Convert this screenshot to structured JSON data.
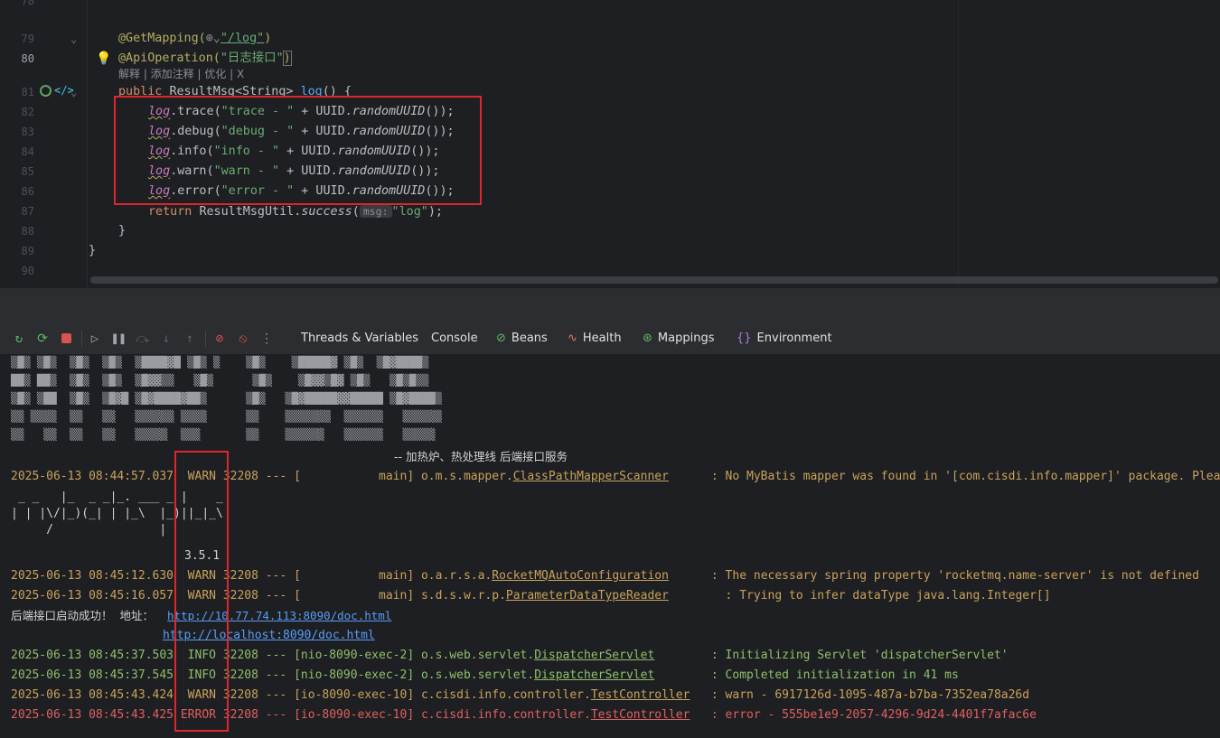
{
  "editor": {
    "line_numbers": [
      "78",
      "79",
      "80",
      "81",
      "82",
      "83",
      "84",
      "85",
      "86",
      "87",
      "88",
      "89",
      "90"
    ],
    "current_line": "80",
    "line79": {
      "ann": "@GetMapping(",
      "path": "\"/log\"",
      "close": ")"
    },
    "line80": {
      "ann": "@ApiOperation(",
      "str": "\"日志接口\"",
      "close": ")"
    },
    "inlay_actions": "解释 | 添加注释 | 优化 | X",
    "line81": {
      "kw": "public ",
      "type": "ResultMsg<String> ",
      "meth": "log",
      "rest": "() {"
    },
    "log_lines": [
      {
        "level": "trace",
        "str": "\"trace - \""
      },
      {
        "level": "debug",
        "str": "\"debug - \""
      },
      {
        "level": "info",
        "str": "\"info - \""
      },
      {
        "level": "warn",
        "str": "\"warn - \""
      },
      {
        "level": "error",
        "str": "\"error - \""
      }
    ],
    "log_var": "log",
    "uuid_call": " + UUID.",
    "uuid_method": "randomUUID",
    "uuid_end": "());",
    "line87": {
      "kw": "return ",
      "cls": "ResultMsgUtil.",
      "meth": "success",
      "open": "(",
      "hint": "msg:",
      "str": "\"log\"",
      "close": ");"
    },
    "line88": "}",
    "line89": "}"
  },
  "toolbar": {
    "tabs": [
      {
        "label": "Threads & Variables",
        "icon": ""
      },
      {
        "label": "Console",
        "icon": ""
      },
      {
        "label": "Beans",
        "icon": "beans-icon"
      },
      {
        "label": "Health",
        "icon": "health-icon"
      },
      {
        "label": "Mappings",
        "icon": "mappings-icon"
      },
      {
        "label": "Environment",
        "icon": "environment-icon"
      }
    ]
  },
  "console": {
    "banner_caption": "-- 加热炉、热处理线 后端接口服务",
    "ascii_version": "3.5.1",
    "ascii_art": [
      " _ _   |_  _ _|_. ___ _ |    _",
      "| | |\\/|_)(_| | |_\\  |_)||_|_\\",
      "     /               |"
    ],
    "lines": [
      {
        "level": "warn",
        "ts": "2025-06-13 08:44:57.037",
        "lvl": "WARN",
        "pid": "32208",
        "sep": "---",
        "thread": "[           main]",
        "pkg": "o.m.s.mapper.",
        "cls": "ClassPathMapperScanner",
        "msg": ": No MyBatis mapper was found in '[com.cisdi.info.mapper]' package. Please check your configuration."
      },
      {
        "level": "warn",
        "ts": "2025-06-13 08:45:12.630",
        "lvl": "WARN",
        "pid": "32208",
        "sep": "---",
        "thread": "[           main]",
        "pkg": "o.a.r.s.a.",
        "cls": "RocketMQAutoConfiguration",
        "msg": ": The necessary spring property 'rocketmq.name-server' is not defined"
      },
      {
        "level": "warn",
        "ts": "2025-06-13 08:45:16.057",
        "lvl": "WARN",
        "pid": "32208",
        "sep": "---",
        "thread": "[           main]",
        "pkg": "s.d.s.w.r.p.",
        "cls": "ParameterDataTypeReader",
        "msg": ": Trying to infer dataType java.lang.Integer[]"
      },
      {
        "level": "info",
        "ts": "2025-06-13 08:45:37.503",
        "lvl": "INFO",
        "pid": "32208",
        "sep": "---",
        "thread": "[nio-8090-exec-2]",
        "pkg": "o.s.web.servlet.",
        "cls": "DispatcherServlet",
        "msg": ": Initializing Servlet 'dispatcherServlet'"
      },
      {
        "level": "info",
        "ts": "2025-06-13 08:45:37.545",
        "lvl": "INFO",
        "pid": "32208",
        "sep": "---",
        "thread": "[nio-8090-exec-2]",
        "pkg": "o.s.web.servlet.",
        "cls": "DispatcherServlet",
        "msg": ": Completed initialization in 41 ms"
      },
      {
        "level": "warn",
        "ts": "2025-06-13 08:45:43.424",
        "lvl": "WARN",
        "pid": "32208",
        "sep": "---",
        "thread": "[io-8090-exec-10]",
        "pkg": "c.cisdi.info.controller.",
        "cls": "TestController",
        "msg": ": warn - 6917126d-1095-487a-b7ba-7352ea78a26d"
      },
      {
        "level": "err",
        "ts": "2025-06-13 08:45:43.425",
        "lvl": "ERROR",
        "pid": "32208",
        "sep": "---",
        "thread": "[io-8090-exec-10]",
        "pkg": "c.cisdi.info.controller.",
        "cls": "TestController",
        "msg": ": error - 555be1e9-2057-4296-9d24-4401f7afac6e"
      }
    ],
    "startup_label": "后端接口启动成功！  地址：",
    "url1": "http://10.77.74.113:8090/doc.html",
    "url2": "http://localhost:8090/doc.html"
  },
  "colors": {
    "highlight": "#e0262d",
    "warn": "#c9a25b",
    "info": "#8fbf6b",
    "error": "#e06060"
  }
}
